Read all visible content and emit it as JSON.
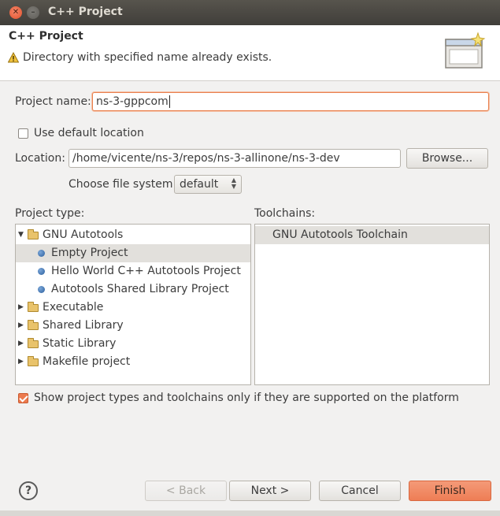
{
  "window": {
    "title": "C++ Project"
  },
  "header": {
    "title": "C++ Project",
    "message": "Directory with specified name already exists."
  },
  "form": {
    "project_name_label": "Project name:",
    "project_name_value": "ns-3-gppcom",
    "use_default_location_label": "Use default location",
    "use_default_location_checked": false,
    "location_label": "Location:",
    "location_value": "/home/vicente/ns-3/repos/ns-3-allinone/ns-3-dev",
    "browse_label": "Browse...",
    "file_system_label": "Choose file system:",
    "file_system_value": "default"
  },
  "project_type": {
    "label": "Project type:",
    "items": [
      {
        "label": "GNU Autotools",
        "kind": "folder",
        "expanded": true,
        "depth": 0
      },
      {
        "label": "Empty Project",
        "kind": "item",
        "depth": 1,
        "selected": true
      },
      {
        "label": "Hello World C++ Autotools Project",
        "kind": "item",
        "depth": 1
      },
      {
        "label": "Autotools Shared Library Project",
        "kind": "item",
        "depth": 1
      },
      {
        "label": "Executable",
        "kind": "folder",
        "expanded": false,
        "depth": 0
      },
      {
        "label": "Shared Library",
        "kind": "folder",
        "expanded": false,
        "depth": 0
      },
      {
        "label": "Static Library",
        "kind": "folder",
        "expanded": false,
        "depth": 0
      },
      {
        "label": "Makefile project",
        "kind": "folder",
        "expanded": false,
        "depth": 0
      }
    ]
  },
  "toolchains": {
    "label": "Toolchains:",
    "items": [
      {
        "label": "GNU Autotools Toolchain",
        "selected": true
      }
    ]
  },
  "filter": {
    "label": "Show project types and toolchains only if they are supported on the platform",
    "checked": true
  },
  "buttons": {
    "back": "< Back",
    "next": "Next >",
    "cancel": "Cancel",
    "finish": "Finish"
  },
  "colors": {
    "accent": "#ee7d55",
    "titlebar": "#403e3a"
  }
}
